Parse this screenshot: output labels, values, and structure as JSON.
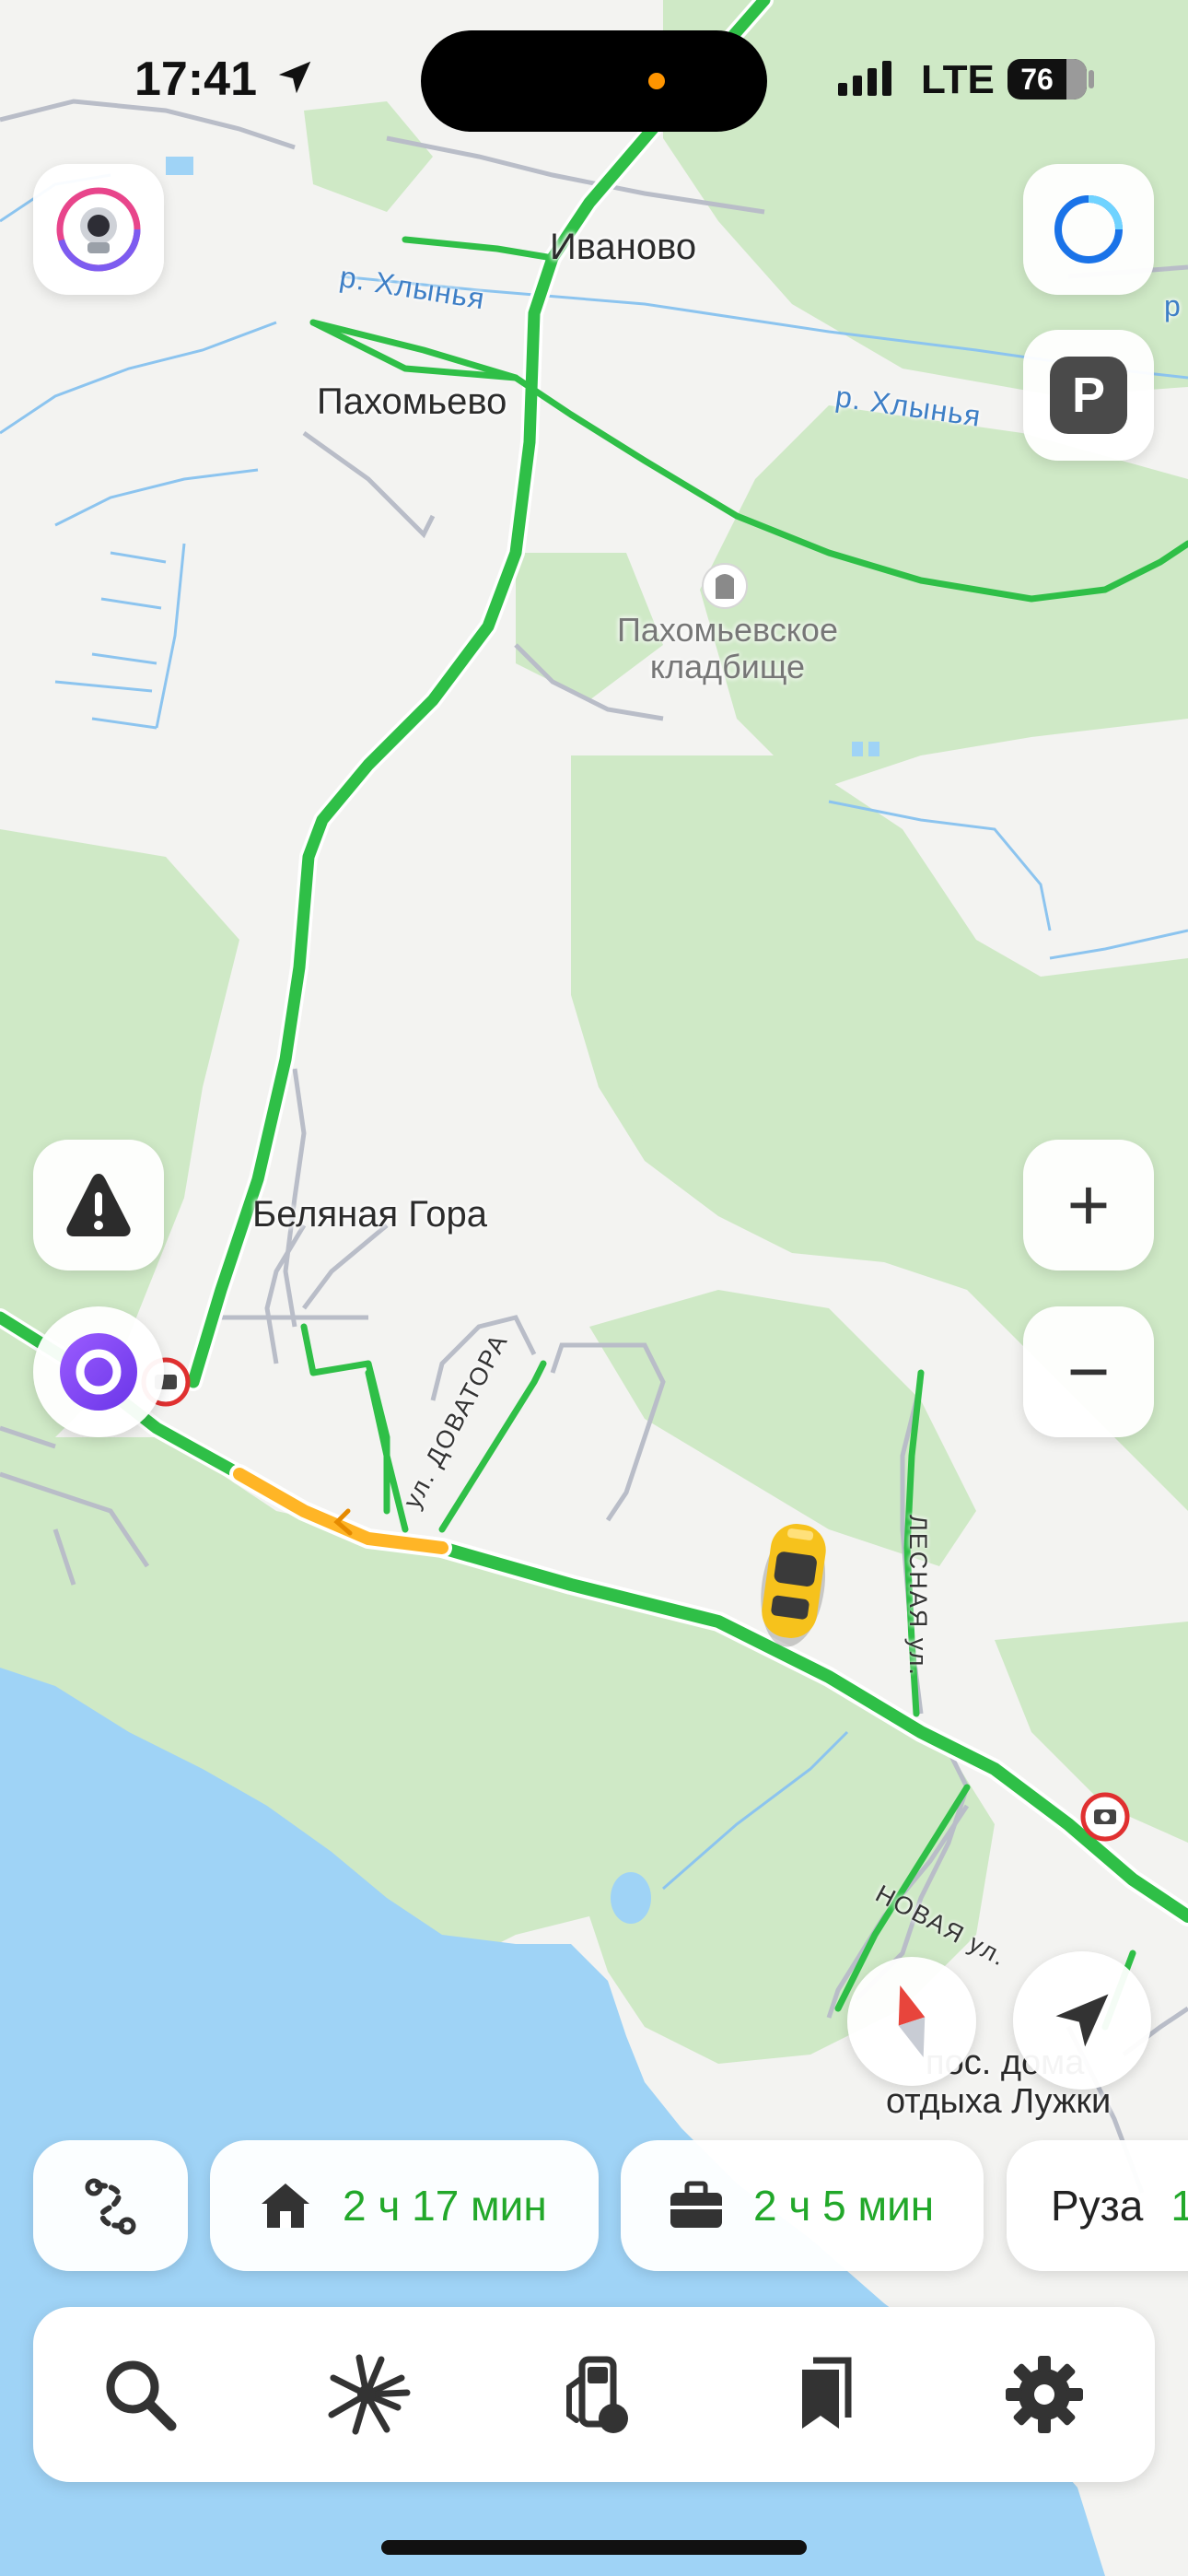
{
  "status_bar": {
    "time": "17:41",
    "network": "LTE",
    "battery": "76"
  },
  "map": {
    "places": {
      "ivanovo": "Иваново",
      "pakhomyevo": "Пахомьево",
      "belyanaya_gora": "Беляная Гора",
      "luzhki_line1": "пос. дома",
      "luzhki_line2": "отдыха Лужки"
    },
    "cemetery": {
      "line1": "Пахомьевское",
      "line2": "кладбище"
    },
    "rivers": {
      "khlynya_1": "р. Хлынья",
      "khlynya_2": "р. Хлынья",
      "khlynya_3": "р"
    },
    "streets": {
      "dovatora": "ул. ДОВАТОРА",
      "lesnaya": "ЛЕСНАЯ ул.",
      "novaya": "НОВАЯ ул."
    },
    "colors": {
      "forest": "#cfe9c6",
      "water": "#9fd3f6",
      "road_free": "#2fbf47",
      "road_slow": "#ffb526",
      "background": "#f3f3f1",
      "camera": "#e03030"
    }
  },
  "shortcuts": [
    {
      "icon": "route-icon",
      "label": ""
    },
    {
      "icon": "home-icon",
      "label": "2 ч 17 мин"
    },
    {
      "icon": "briefcase-icon",
      "label": "2 ч 5 мин"
    },
    {
      "icon": "",
      "label": "Руза",
      "value": "1"
    }
  ],
  "bottom_nav": [
    {
      "icon": "search-icon"
    },
    {
      "icon": "discovery-icon"
    },
    {
      "icon": "fuel-icon"
    },
    {
      "icon": "bookmarks-icon"
    },
    {
      "icon": "gear-icon"
    }
  ],
  "side_controls": {
    "zoom_in": "+",
    "zoom_out": "−",
    "parking": "P"
  }
}
